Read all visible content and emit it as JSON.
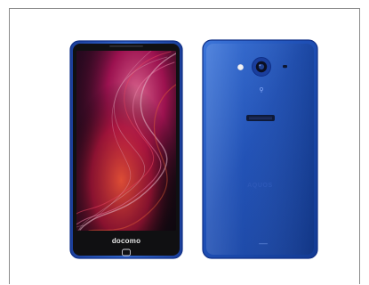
{
  "product": {
    "front": {
      "carrier_logo_text": "docomo"
    },
    "back": {
      "brand_text": "AQUOS"
    },
    "colors": {
      "body_blue": "#1e4fb5",
      "frame_edge": "#0f2f86",
      "screen_dark": "#1a1a1c",
      "wallpaper_accent": "#d6176b",
      "wallpaper_highlight": "#ff4b6a",
      "frame_border": "#8a8a8a"
    }
  }
}
